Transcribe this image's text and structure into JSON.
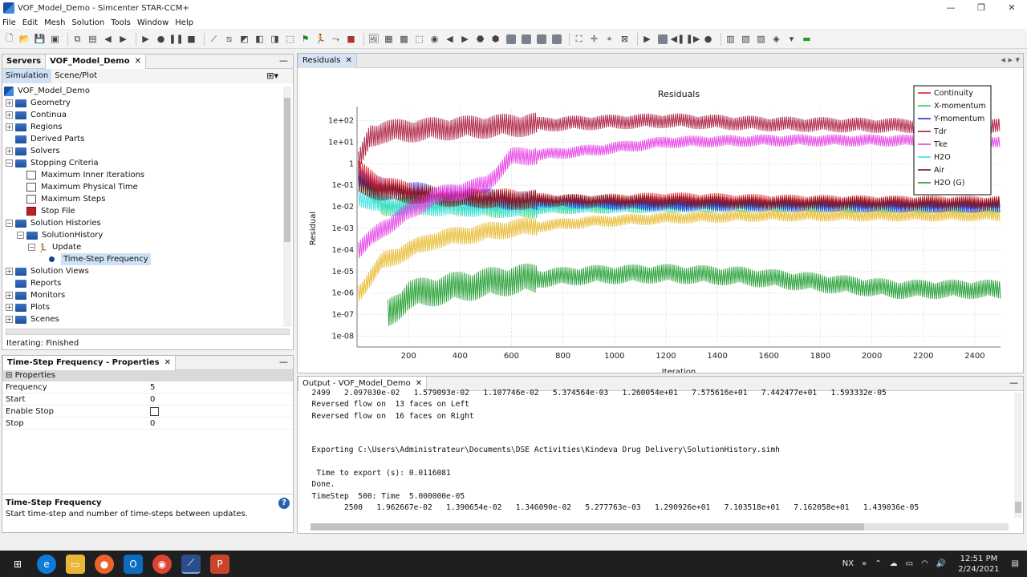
{
  "window": {
    "title": "VOF_Model_Demo - Simcenter STAR-CCM+",
    "controls": [
      "—",
      "❐",
      "✕"
    ]
  },
  "menu": [
    "File",
    "Edit",
    "Mesh",
    "Solution",
    "Tools",
    "Window",
    "Help"
  ],
  "left_top": {
    "tabs": [
      {
        "label": "Servers"
      },
      {
        "label": "VOF_Model_Demo",
        "close": "✕"
      }
    ],
    "minimize": "—",
    "subtabs": [
      "Simulation",
      "Scene/Plot"
    ],
    "root": "VOF_Model_Demo",
    "tree": [
      {
        "label": "Geometry",
        "level": 1,
        "expander": "+",
        "icon": "folder"
      },
      {
        "label": "Continua",
        "level": 1,
        "expander": "+",
        "icon": "folder"
      },
      {
        "label": "Regions",
        "level": 1,
        "expander": "+",
        "icon": "folder"
      },
      {
        "label": "Derived Parts",
        "level": 1,
        "expander": "",
        "icon": "folder"
      },
      {
        "label": "Solvers",
        "level": 1,
        "expander": "+",
        "icon": "folder"
      },
      {
        "label": "Stopping Criteria",
        "level": 1,
        "expander": "−",
        "icon": "folder"
      },
      {
        "label": "Maximum Inner Iterations",
        "level": 2,
        "expander": "",
        "icon": "criterion"
      },
      {
        "label": "Maximum Physical Time",
        "level": 2,
        "expander": "",
        "icon": "criterion"
      },
      {
        "label": "Maximum Steps",
        "level": 2,
        "expander": "",
        "icon": "criterion"
      },
      {
        "label": "Stop File",
        "level": 2,
        "expander": "",
        "icon": "stop-file"
      },
      {
        "label": "Solution Histories",
        "level": 1,
        "expander": "−",
        "icon": "folder"
      },
      {
        "label": "SolutionHistory",
        "level": 2,
        "expander": "−",
        "icon": "history"
      },
      {
        "label": "Update",
        "level": 3,
        "expander": "−",
        "icon": "update"
      },
      {
        "label": "Time-Step Frequency",
        "level": 4,
        "expander": "",
        "icon": "dot",
        "selected": true
      },
      {
        "label": "Solution Views",
        "level": 1,
        "expander": "+",
        "icon": "folder"
      },
      {
        "label": "Reports",
        "level": 1,
        "expander": "",
        "icon": "folder"
      },
      {
        "label": "Monitors",
        "level": 1,
        "expander": "+",
        "icon": "folder"
      },
      {
        "label": "Plots",
        "level": 1,
        "expander": "+",
        "icon": "folder"
      },
      {
        "label": "Scenes",
        "level": 1,
        "expander": "+",
        "icon": "folder"
      }
    ],
    "status": "Iterating: Finished"
  },
  "properties": {
    "title": "Time-Step Frequency - Properties",
    "close": "✕",
    "minimize": "—",
    "section": "Properties",
    "rows": [
      {
        "key": "Frequency",
        "value": "5"
      },
      {
        "key": "Start",
        "value": "0"
      },
      {
        "key": "Enable Stop",
        "value": "",
        "checkbox": true
      },
      {
        "key": "Stop",
        "value": "0"
      }
    ],
    "help_title": "Time-Step Frequency",
    "help_text": "Start time-step and number of time-steps between updates.",
    "help_icon": "?"
  },
  "plot_tab": {
    "label": "Residuals",
    "close": "✕"
  },
  "chart_data": {
    "type": "line",
    "title": "Residuals",
    "xlabel": "Iteration",
    "ylabel": "Residual",
    "xlim": [
      0,
      2500
    ],
    "ylim_log10": [
      -8.5,
      2.5
    ],
    "yscale": "log",
    "xticks": [
      200,
      400,
      600,
      800,
      1000,
      1200,
      1400,
      1600,
      1800,
      2000,
      2200,
      2400
    ],
    "yticks": [
      "1e+02",
      "1e+01",
      "1",
      "1e-01",
      "1e-02",
      "1e-03",
      "1e-04",
      "1e-05",
      "1e-06",
      "1e-07",
      "1e-08"
    ],
    "grid": true,
    "legend_position": "top-right",
    "series": [
      {
        "name": "Continuity",
        "color": "#e0202a",
        "x": [
          5,
          100,
          300,
          600,
          900,
          1200,
          1600,
          2000,
          2500
        ],
        "y": [
          0.5,
          0.1,
          0.03,
          0.025,
          0.02,
          0.025,
          0.02,
          0.018,
          0.017
        ]
      },
      {
        "name": "X-momentum",
        "color": "#2fd15a",
        "x": [
          5,
          100,
          300,
          600,
          900,
          1200,
          1600,
          2000,
          2500
        ],
        "y": [
          0.2,
          0.01,
          0.012,
          0.008,
          0.009,
          0.01,
          0.011,
          0.01,
          0.01
        ]
      },
      {
        "name": "Y-momentum",
        "color": "#2b2bd8",
        "x": [
          5,
          100,
          300,
          600,
          900,
          1200,
          1600,
          2000,
          2500
        ],
        "y": [
          0.3,
          0.08,
          0.04,
          0.02,
          0.015,
          0.012,
          0.012,
          0.011,
          0.01
        ]
      },
      {
        "name": "Tdr",
        "color": "#a9163a",
        "x": [
          5,
          50,
          100,
          300,
          600,
          900,
          1200,
          1600,
          2000,
          2500
        ],
        "y": [
          1,
          20,
          30,
          40,
          60,
          80,
          100,
          70,
          60,
          55
        ]
      },
      {
        "name": "Tke",
        "color": "#e43ce4",
        "x": [
          5,
          100,
          300,
          500,
          600,
          900,
          1200,
          1600,
          2000,
          2500
        ],
        "y": [
          0.0001,
          0.001,
          0.03,
          0.1,
          2,
          4,
          10,
          12,
          12,
          11
        ]
      },
      {
        "name": "H2O",
        "color": "#38e0e0",
        "x": [
          5,
          100,
          300,
          600,
          900,
          1200,
          1600,
          2000,
          2500
        ],
        "y": [
          0.03,
          0.012,
          0.01,
          0.009,
          0.01,
          0.01,
          0.011,
          0.01,
          0.01
        ]
      },
      {
        "name": "Air",
        "color": "#7a1420",
        "x": [
          5,
          100,
          300,
          600,
          900,
          1200,
          1600,
          2000,
          2500
        ],
        "y": [
          0.1,
          0.05,
          0.03,
          0.02,
          0.02,
          0.018,
          0.015,
          0.015,
          0.014
        ]
      },
      {
        "name": "H2O (G)",
        "color": "#1a9a2a",
        "x": [
          120,
          200,
          400,
          600,
          900,
          1200,
          1500,
          1800,
          2100,
          2500
        ],
        "y": [
          1e-07,
          8e-07,
          2e-06,
          4e-06,
          7e-06,
          8e-06,
          6e-06,
          3e-06,
          1.5e-06,
          1.5e-06
        ]
      },
      {
        "name": "",
        "color": "#e8b82a",
        "x": [
          5,
          100,
          300,
          600,
          900,
          1200,
          1600,
          2000,
          2500
        ],
        "y": [
          1e-06,
          3e-05,
          0.0003,
          0.001,
          0.002,
          0.003,
          0.004,
          0.004,
          0.004
        ]
      }
    ]
  },
  "output": {
    "tab": {
      "label": "Output - VOF_Model_Demo",
      "close": "✕"
    },
    "minimize": "—",
    "lines": [
      "  2499   2.097030e-02   1.579093e-02   1.107746e-02   5.374564e-03   1.260054e+01   7.575616e+01   7.442477e+01   1.593332e-05",
      "  Reversed flow on  13 faces on Left",
      "  Reversed flow on  16 faces on Right",
      "",
      "",
      "  Exporting C:\\Users\\Administrateur\\Documents\\DSE Activities\\Kindeva Drug Delivery\\SolutionHistory.simh",
      "",
      "   Time to export (s): 0.0116081",
      "  Done.",
      "  TimeStep  500: Time  5.000000e-05",
      "         2500   1.962667e-02   1.390654e-02   1.346090e-02   5.277763e-03   1.290926e+01   7.103518e+01   7.162058e+01   1.439036e-05"
    ]
  },
  "taskbar": {
    "tray_label": "NX",
    "time": "12:51 PM",
    "date": "2/24/2021"
  }
}
